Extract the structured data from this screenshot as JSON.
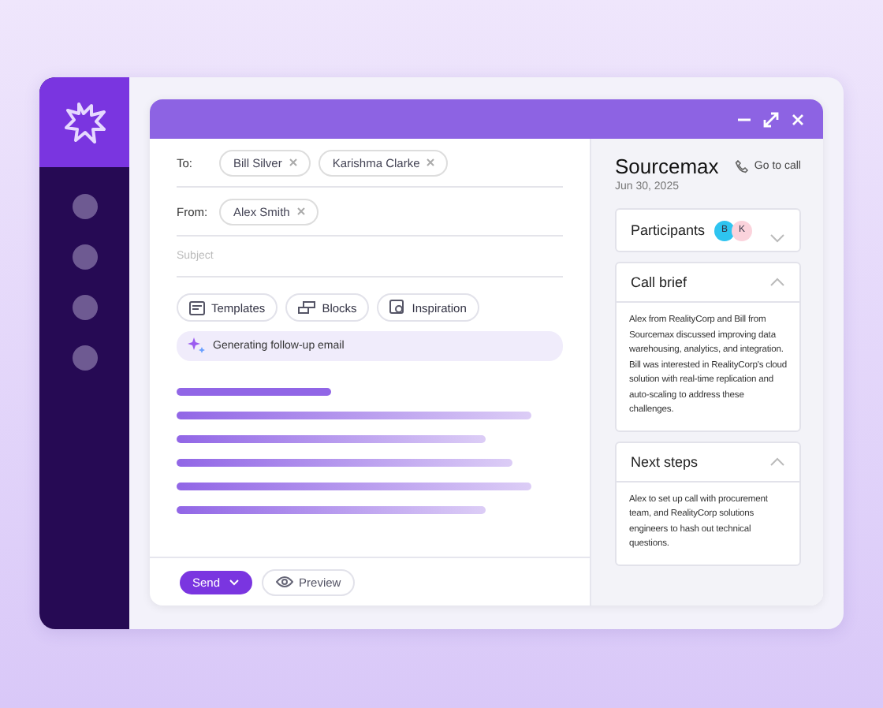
{
  "compose": {
    "to_label": "To:",
    "to": [
      {
        "name": "Bill Silver"
      },
      {
        "name": "Karishma Clarke"
      }
    ],
    "from_label": "From:",
    "from": [
      {
        "name": "Alex Smith"
      }
    ],
    "subject": {
      "placeholder": "Subject"
    },
    "tools": [
      {
        "label": "Templates",
        "kind": "templates"
      },
      {
        "label": "Blocks",
        "kind": "blocks"
      },
      {
        "label": "Inspiration",
        "kind": "inspiration"
      }
    ],
    "status": "Generating follow-up email",
    "send": "Send",
    "preview": "Preview"
  },
  "call": {
    "title": "Sourcemax",
    "date": "Jun 30, 2025",
    "go_to_call": "Go to call",
    "sections": [
      {
        "title": "Participants",
        "expanded": false,
        "avatars": [
          {
            "initial": "B",
            "color": "#2ec4f0"
          },
          {
            "initial": "K",
            "color": "#fbd3dc"
          }
        ]
      },
      {
        "title": "Call brief",
        "expanded": true,
        "body": "Alex from RealityCorp and Bill from Sourcemax discussed improving data warehousing, analytics, and integration. Bill was interested in RealityCorp's cloud solution with real-time replication and auto-scaling to address these challenges."
      },
      {
        "title": "Next steps",
        "expanded": true,
        "body": "Alex to set up call with procurement team, and RealityCorp solutions engineers to hash out technical questions."
      }
    ]
  }
}
